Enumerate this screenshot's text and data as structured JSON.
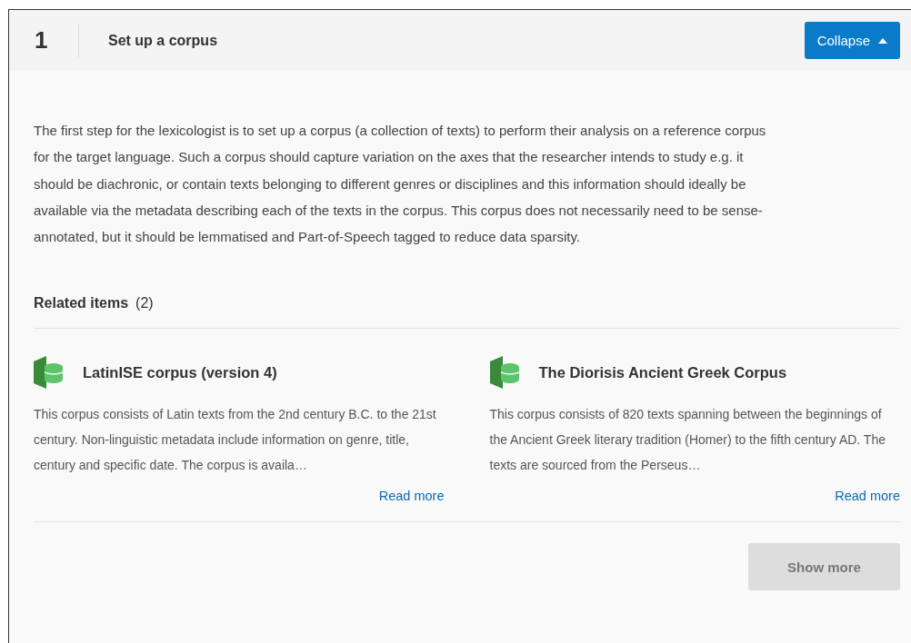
{
  "step": {
    "number": "1",
    "title": "Set up a corpus",
    "toggle": {
      "label": "Collapse",
      "expanded": true
    }
  },
  "description": "The first step for the lexicologist is to set up a corpus (a collection of texts) to perform their analysis on a reference corpus for the target language. Such a corpus should capture variation on the axes that the researcher intends to study e.g. it should be diachronic, or contain texts belonging to different genres or disciplines and this information should ideally be available via the metadata describing each of the texts in the corpus. This corpus does not necessarily need to be sense-annotated, but it should be lemmatised and Part-of-Speech tagged to reduce data sparsity.",
  "related": {
    "heading": "Related items",
    "count": "(2)",
    "items": [
      {
        "title": "LatinISE corpus (version 4)",
        "summary": "This corpus consists of Latin texts from the 2nd century B.C. to the 21st century. Non-linguistic metadata include information on genre, title, century and specific date. The corpus is availa…",
        "link": "Read more"
      },
      {
        "title": "The Diorisis Ancient Greek Corpus",
        "summary": "This corpus consists of 820 texts spanning between the beginnings of the Ancient Greek literary tradition (Homer) to the fifth century AD. The texts are sourced from the Perseus…",
        "link": "Read more"
      }
    ],
    "show_more": {
      "label": "Show more",
      "disabled": true
    }
  }
}
